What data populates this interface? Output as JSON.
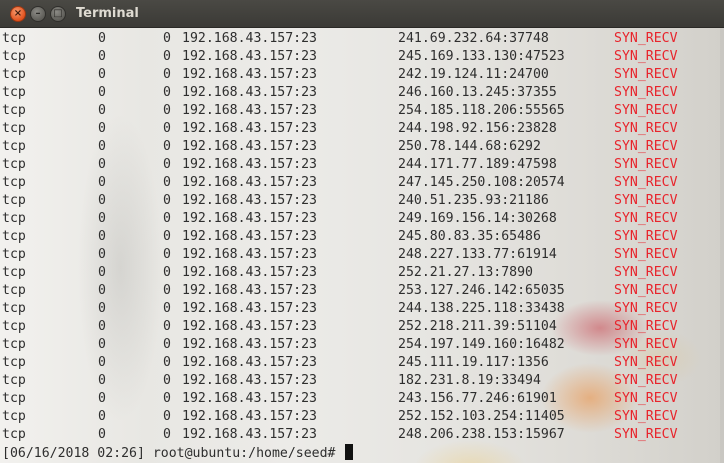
{
  "window": {
    "title": "Terminal",
    "close_glyph": "×",
    "minimize_glyph": "–",
    "maximize_glyph": "□"
  },
  "colors": {
    "state_color": "#e8242c",
    "close_button": "#e1521e",
    "titlebar": "#3c3b37"
  },
  "connections": [
    {
      "proto": "tcp",
      "recv_q": "0",
      "send_q": "0",
      "local": "192.168.43.157:23",
      "foreign": "241.69.232.64:37748",
      "state": "SYN_RECV"
    },
    {
      "proto": "tcp",
      "recv_q": "0",
      "send_q": "0",
      "local": "192.168.43.157:23",
      "foreign": "245.169.133.130:47523",
      "state": "SYN_RECV"
    },
    {
      "proto": "tcp",
      "recv_q": "0",
      "send_q": "0",
      "local": "192.168.43.157:23",
      "foreign": "242.19.124.11:24700",
      "state": "SYN_RECV"
    },
    {
      "proto": "tcp",
      "recv_q": "0",
      "send_q": "0",
      "local": "192.168.43.157:23",
      "foreign": "246.160.13.245:37355",
      "state": "SYN_RECV"
    },
    {
      "proto": "tcp",
      "recv_q": "0",
      "send_q": "0",
      "local": "192.168.43.157:23",
      "foreign": "254.185.118.206:55565",
      "state": "SYN_RECV"
    },
    {
      "proto": "tcp",
      "recv_q": "0",
      "send_q": "0",
      "local": "192.168.43.157:23",
      "foreign": "244.198.92.156:23828",
      "state": "SYN_RECV"
    },
    {
      "proto": "tcp",
      "recv_q": "0",
      "send_q": "0",
      "local": "192.168.43.157:23",
      "foreign": "250.78.144.68:6292",
      "state": "SYN_RECV"
    },
    {
      "proto": "tcp",
      "recv_q": "0",
      "send_q": "0",
      "local": "192.168.43.157:23",
      "foreign": "244.171.77.189:47598",
      "state": "SYN_RECV"
    },
    {
      "proto": "tcp",
      "recv_q": "0",
      "send_q": "0",
      "local": "192.168.43.157:23",
      "foreign": "247.145.250.108:20574",
      "state": "SYN_RECV"
    },
    {
      "proto": "tcp",
      "recv_q": "0",
      "send_q": "0",
      "local": "192.168.43.157:23",
      "foreign": "240.51.235.93:21186",
      "state": "SYN_RECV"
    },
    {
      "proto": "tcp",
      "recv_q": "0",
      "send_q": "0",
      "local": "192.168.43.157:23",
      "foreign": "249.169.156.14:30268",
      "state": "SYN_RECV"
    },
    {
      "proto": "tcp",
      "recv_q": "0",
      "send_q": "0",
      "local": "192.168.43.157:23",
      "foreign": "245.80.83.35:65486",
      "state": "SYN_RECV"
    },
    {
      "proto": "tcp",
      "recv_q": "0",
      "send_q": "0",
      "local": "192.168.43.157:23",
      "foreign": "248.227.133.77:61914",
      "state": "SYN_RECV"
    },
    {
      "proto": "tcp",
      "recv_q": "0",
      "send_q": "0",
      "local": "192.168.43.157:23",
      "foreign": "252.21.27.13:7890",
      "state": "SYN_RECV"
    },
    {
      "proto": "tcp",
      "recv_q": "0",
      "send_q": "0",
      "local": "192.168.43.157:23",
      "foreign": "253.127.246.142:65035",
      "state": "SYN_RECV"
    },
    {
      "proto": "tcp",
      "recv_q": "0",
      "send_q": "0",
      "local": "192.168.43.157:23",
      "foreign": "244.138.225.118:33438",
      "state": "SYN_RECV"
    },
    {
      "proto": "tcp",
      "recv_q": "0",
      "send_q": "0",
      "local": "192.168.43.157:23",
      "foreign": "252.218.211.39:51104",
      "state": "SYN_RECV"
    },
    {
      "proto": "tcp",
      "recv_q": "0",
      "send_q": "0",
      "local": "192.168.43.157:23",
      "foreign": "254.197.149.160:16482",
      "state": "SYN_RECV"
    },
    {
      "proto": "tcp",
      "recv_q": "0",
      "send_q": "0",
      "local": "192.168.43.157:23",
      "foreign": "245.111.19.117:1356",
      "state": "SYN_RECV"
    },
    {
      "proto": "tcp",
      "recv_q": "0",
      "send_q": "0",
      "local": "192.168.43.157:23",
      "foreign": "182.231.8.19:33494",
      "state": "SYN_RECV"
    },
    {
      "proto": "tcp",
      "recv_q": "0",
      "send_q": "0",
      "local": "192.168.43.157:23",
      "foreign": "243.156.77.246:61901",
      "state": "SYN_RECV"
    },
    {
      "proto": "tcp",
      "recv_q": "0",
      "send_q": "0",
      "local": "192.168.43.157:23",
      "foreign": "252.152.103.254:11405",
      "state": "SYN_RECV"
    },
    {
      "proto": "tcp",
      "recv_q": "0",
      "send_q": "0",
      "local": "192.168.43.157:23",
      "foreign": "248.206.238.153:15967",
      "state": "SYN_RECV"
    }
  ],
  "prompt": {
    "text": "[06/16/2018 02:26] root@ubuntu:/home/seed# "
  }
}
